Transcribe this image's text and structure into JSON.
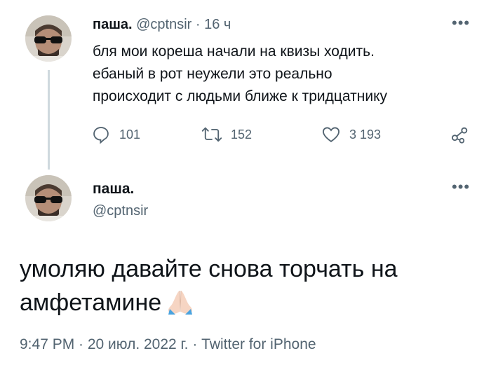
{
  "tweet1": {
    "name": "паша.",
    "handle": "@cptnsir",
    "sep": " · ",
    "time": "16 ч",
    "text_lines": [
      "бля мои кореша начали на квизы ходить.",
      "ебаный в рот неужели это реально",
      "происходит с людьми ближе к тридцатнику"
    ],
    "replies": "101",
    "retweets": "152",
    "likes": "3 193"
  },
  "tweet2": {
    "name": "паша.",
    "handle": "@cptnsir",
    "text_line1": "умоляю давайте снова торчать на",
    "text_line2": "амфетамине",
    "footer": "9:47 PM · 20 июл. 2022 г. · Twitter for iPhone"
  },
  "icons": {
    "more": "more-horizontal-icon",
    "reply": "reply-bubble-icon",
    "retweet": "retweet-icon",
    "like": "heart-icon",
    "share": "share-icon",
    "emoji": "folded-hands-emoji"
  },
  "colors": {
    "text": "#0f1419",
    "secondary": "#536471",
    "thread_line": "#cfd9de"
  }
}
